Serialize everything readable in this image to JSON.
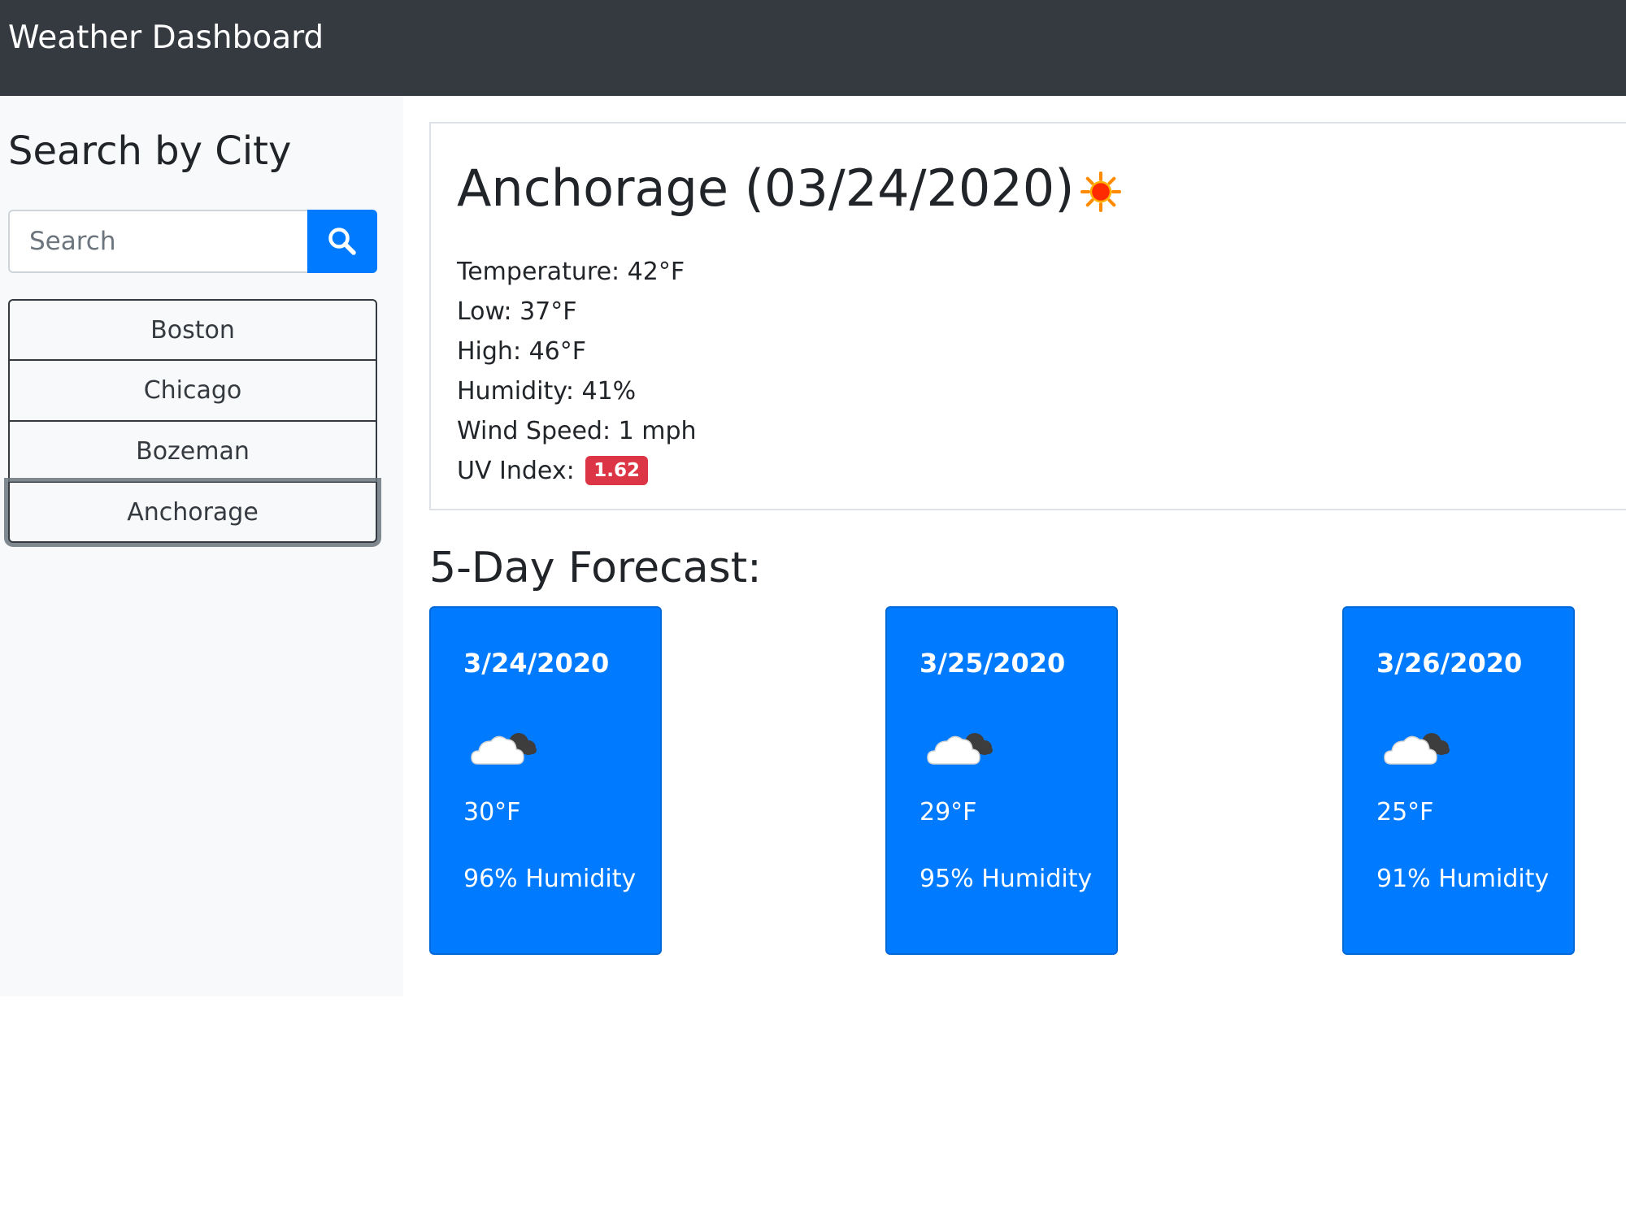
{
  "navbar": {
    "brand": "Weather Dashboard"
  },
  "sidebar": {
    "title": "Search by City",
    "search": {
      "placeholder": "Search",
      "value": ""
    },
    "search_button_icon": "search-icon",
    "cities": [
      {
        "label": "Boston",
        "active": false
      },
      {
        "label": "Chicago",
        "active": false
      },
      {
        "label": "Bozeman",
        "active": false
      },
      {
        "label": "Anchorage",
        "active": true
      }
    ]
  },
  "current": {
    "title": "Anchorage (03/24/2020)",
    "icon": "sun-icon",
    "temperature": "Temperature: 42°F",
    "low": "Low: 37°F",
    "high": "High: 46°F",
    "humidity": "Humidity: 41%",
    "wind": "Wind Speed: 1 mph",
    "uv_label": "UV Index:",
    "uv_value": "1.62"
  },
  "forecast": {
    "title": "5-Day Forecast:",
    "days": [
      {
        "date": "3/24/2020",
        "icon": "cloud-icon",
        "temp": "30°F",
        "humidity": "96% Humidity"
      },
      {
        "date": "3/25/2020",
        "icon": "cloud-icon",
        "temp": "29°F",
        "humidity": "95% Humidity"
      },
      {
        "date": "3/26/2020",
        "icon": "cloud-icon",
        "temp": "25°F",
        "humidity": "91% Humidity"
      }
    ]
  },
  "colors": {
    "navbar": "#343a40",
    "primary": "#007bff",
    "danger": "#dc3545",
    "sidebar_bg": "#f8f9fa"
  }
}
